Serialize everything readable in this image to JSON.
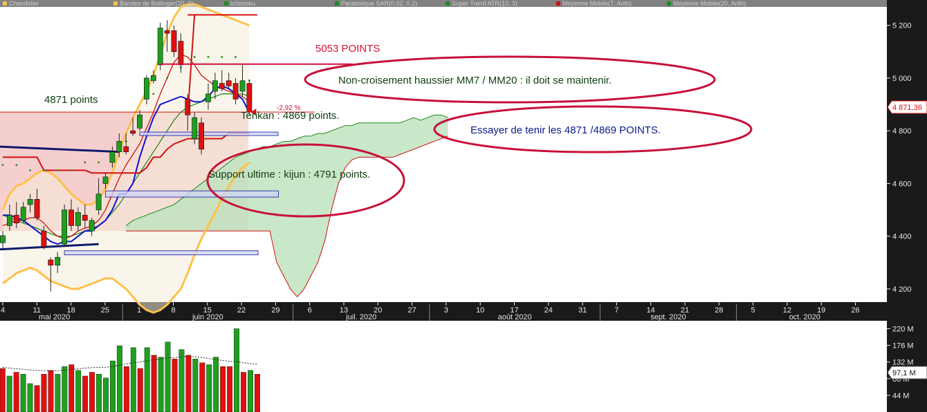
{
  "legend": [
    {
      "label": "Chandelier",
      "color": "#ffc04a"
    },
    {
      "label": "Bandes de Bollinger(20, 2)",
      "color": "#ffc04a"
    },
    {
      "label": "Ichimoku",
      "color": "#1e8a1e"
    },
    {
      "label": "Parabolique SAR(0.02, 0.2)",
      "color": "#1e8a1e"
    },
    {
      "label": "Super Trend ATR(10, 3)",
      "color": "#1e8a1e"
    },
    {
      "label": "Moyenne Mobile(7, Arith)",
      "color": "#d01010"
    },
    {
      "label": "Moyenne Mobile(20, Arith)",
      "color": "#1e8a1e"
    }
  ],
  "annotations": {
    "points_5053": "5053 POINTS",
    "mm_note": "Non-croisement haussier MM7 / MM20 : il doit se maintenir.",
    "points_4871": "4871 points",
    "tenkan": "Tenkan : 4869 points.",
    "pct_change": "-2,92 %",
    "hold_note": "Essayer de tenir les 4871  /4869 POINTS.",
    "kijun": "Support ultime : kijun : 4791 points."
  },
  "price_badge": "4 871,36",
  "volume_badge": "97,1 M",
  "colors": {
    "up": "#1ea01e",
    "down": "#e01010",
    "bollinger": "#ffc04a",
    "annotation_ring": "#c8103a",
    "kumo_fill": "#bfe3bf",
    "shaded_zone": "#f3c2c2",
    "axis_bg": "#1a1a1a"
  },
  "chart_data": [
    {
      "type": "candlestick",
      "y_ticks": [
        "5 200",
        "5 000",
        "4 800",
        "4 600",
        "4 400",
        "4 200"
      ],
      "y_tick_values": [
        5200,
        5000,
        4800,
        4600,
        4400,
        4200
      ],
      "ylim": [
        4150,
        5270
      ],
      "x_tick_labels": [
        "4",
        "11",
        "18",
        "25",
        "1",
        "8",
        "15",
        "22",
        "29",
        "6",
        "13",
        "20",
        "27",
        "3",
        "10",
        "17",
        "24",
        "31",
        "7",
        "14",
        "21",
        "28",
        "5",
        "12",
        "19",
        "26"
      ],
      "months": [
        {
          "label": "mai 2020",
          "start": "4"
        },
        {
          "label": "juin 2020",
          "start": "1"
        },
        {
          "label": "juil. 2020",
          "start": "6"
        },
        {
          "label": "août 2020",
          "start": "3"
        },
        {
          "label": "sept. 2020",
          "start": "7"
        },
        {
          "label": "oct. 2020",
          "start": "5"
        }
      ],
      "candles": [
        {
          "o": 4375,
          "h": 4420,
          "l": 4350,
          "c": 4402
        },
        {
          "o": 4440,
          "h": 4520,
          "l": 4420,
          "c": 4480
        },
        {
          "o": 4480,
          "h": 4530,
          "l": 4430,
          "c": 4450
        },
        {
          "o": 4460,
          "h": 4530,
          "l": 4450,
          "c": 4510
        },
        {
          "o": 4520,
          "h": 4560,
          "l": 4490,
          "c": 4540
        },
        {
          "o": 4540,
          "h": 4580,
          "l": 4460,
          "c": 4470
        },
        {
          "o": 4420,
          "h": 4440,
          "l": 4350,
          "c": 4360
        },
        {
          "o": 4310,
          "h": 4320,
          "l": 4190,
          "c": 4290
        },
        {
          "o": 4290,
          "h": 4340,
          "l": 4260,
          "c": 4320
        },
        {
          "o": 4370,
          "h": 4520,
          "l": 4360,
          "c": 4500
        },
        {
          "o": 4500,
          "h": 4540,
          "l": 4420,
          "c": 4440
        },
        {
          "o": 4440,
          "h": 4510,
          "l": 4420,
          "c": 4490
        },
        {
          "o": 4480,
          "h": 4520,
          "l": 4430,
          "c": 4460
        },
        {
          "o": 4420,
          "h": 4470,
          "l": 4400,
          "c": 4460
        },
        {
          "o": 4500,
          "h": 4620,
          "l": 4480,
          "c": 4560
        },
        {
          "o": 4600,
          "h": 4640,
          "l": 4580,
          "c": 4625
        },
        {
          "o": 4680,
          "h": 4740,
          "l": 4660,
          "c": 4720
        },
        {
          "o": 4720,
          "h": 4790,
          "l": 4700,
          "c": 4760
        },
        {
          "o": 4740,
          "h": 4790,
          "l": 4710,
          "c": 4720
        },
        {
          "o": 4800,
          "h": 4850,
          "l": 4780,
          "c": 4790
        },
        {
          "o": 4810,
          "h": 4880,
          "l": 4800,
          "c": 4860
        },
        {
          "o": 4920,
          "h": 5010,
          "l": 4900,
          "c": 5000
        },
        {
          "o": 4990,
          "h": 5030,
          "l": 4980,
          "c": 5010
        },
        {
          "o": 5050,
          "h": 5210,
          "l": 5030,
          "c": 5190
        },
        {
          "o": 5180,
          "h": 5220,
          "l": 5100,
          "c": 5170
        },
        {
          "o": 5180,
          "h": 5200,
          "l": 5080,
          "c": 5100
        },
        {
          "o": 5140,
          "h": 5170,
          "l": 5020,
          "c": 5050
        },
        {
          "o": 4920,
          "h": 4940,
          "l": 4800,
          "c": 4860
        },
        {
          "o": 4770,
          "h": 4870,
          "l": 4750,
          "c": 4850
        },
        {
          "o": 4830,
          "h": 4850,
          "l": 4710,
          "c": 4730
        },
        {
          "o": 4910,
          "h": 4980,
          "l": 4880,
          "c": 4940
        },
        {
          "o": 4950,
          "h": 5020,
          "l": 4920,
          "c": 4990
        },
        {
          "o": 4980,
          "h": 5030,
          "l": 4950,
          "c": 4960
        },
        {
          "o": 4990,
          "h": 5020,
          "l": 4960,
          "c": 4970
        },
        {
          "o": 4980,
          "h": 5000,
          "l": 4900,
          "c": 4920
        },
        {
          "o": 4950,
          "h": 5050,
          "l": 4930,
          "c": 4990
        },
        {
          "o": 4980,
          "h": 4990,
          "l": 4860,
          "c": 4871
        }
      ],
      "bollinger_upper": [
        4500,
        4560,
        4590,
        4600,
        4620,
        4640,
        4650,
        4640,
        4620,
        4590,
        4560,
        4540,
        4520,
        4520,
        4540,
        4580,
        4640,
        4720,
        4790,
        4850,
        4900,
        4950,
        5010,
        5090,
        5170,
        5230,
        5270,
        5280,
        5280,
        5270,
        5260,
        5250,
        5240,
        5230,
        5220,
        5210,
        5200
      ],
      "bollinger_lower": [
        4220,
        4240,
        4260,
        4270,
        4280,
        4270,
        4250,
        4230,
        4220,
        4210,
        4200,
        4200,
        4210,
        4220,
        4230,
        4240,
        4240,
        4220,
        4200,
        4170,
        4140,
        4120,
        4110,
        4120,
        4140,
        4170,
        4200,
        4260,
        4330,
        4390,
        4440,
        4490,
        4540,
        4590,
        4630,
        4660,
        4680
      ],
      "mm7": [
        4440,
        4450,
        4460,
        4460,
        4470,
        4470,
        4450,
        4420,
        4400,
        4390,
        4400,
        4420,
        4430,
        4440,
        4460,
        4500,
        4560,
        4620,
        4670,
        4710,
        4750,
        4810,
        4870,
        4940,
        5000,
        5060,
        5090,
        5080,
        5050,
        5010,
        4990,
        4970,
        4960,
        4950,
        4940,
        4930,
        4910
      ],
      "mm20": [
        4480,
        4470,
        4460,
        4450,
        4440,
        4430,
        4420,
        4410,
        4400,
        4400,
        4400,
        4410,
        4420,
        4430,
        4440,
        4460,
        4490,
        4520,
        4560,
        4600,
        4640,
        4680,
        4720,
        4760,
        4800,
        4840,
        4870,
        4890,
        4900,
        4910,
        4920,
        4930,
        4940,
        4940,
        4940,
        4940,
        4930
      ],
      "tenkan": [
        4480,
        4480,
        4470,
        4460,
        4440,
        4420,
        4400,
        4380,
        4370,
        4380,
        4380,
        4400,
        4420,
        4420,
        4440,
        4460,
        4500,
        4560,
        4560,
        4600,
        4700,
        4780,
        4850,
        4900,
        4910,
        4920,
        4930,
        4920,
        4910,
        4910,
        4930,
        4960,
        4970,
        4960,
        4940,
        4920,
        4869
      ],
      "kijun": [
        4700,
        4700,
        4700,
        4700,
        4700,
        4700,
        4650,
        4650,
        4650,
        4650,
        4650,
        4650,
        4650,
        4640,
        4640,
        4640,
        4640,
        4640,
        4640,
        4640,
        4640,
        4660,
        4700,
        4700,
        4730,
        4750,
        4760,
        4770,
        4770,
        4770,
        4770,
        4770,
        4770,
        4791,
        4791,
        4791,
        4791
      ],
      "supertrend": [
        4550,
        4550,
        4550,
        4540,
        4530,
        4530,
        4530,
        4530,
        4530,
        4530,
        4530,
        4540,
        4560,
        4560,
        4560,
        4600,
        4600,
        4620,
        4640,
        4680,
        4730,
        4800,
        4820,
        4860,
        4880,
        4900,
        4920,
        4960,
        4960,
        4960,
        4960,
        4960,
        4960,
        4960,
        4960,
        4960,
        4871
      ],
      "kumo": {
        "start_index": 18,
        "span_a": [
          4440,
          4460,
          4470,
          4480,
          4490,
          4500,
          4510,
          4520,
          4540,
          4560,
          4580,
          4600,
          4620,
          4640,
          4660,
          4680,
          4700,
          4710,
          4720,
          4730,
          4740,
          4740,
          4750,
          4760,
          4760,
          4770,
          4780,
          4780,
          4790,
          4790,
          4800,
          4810,
          4820,
          4820,
          4830,
          4830,
          4830,
          4830,
          4830,
          4830,
          4830,
          4840,
          4850,
          4840,
          4850,
          4860,
          4860,
          4850
        ],
        "span_b": [
          4420,
          4420,
          4420,
          4420,
          4420,
          4420,
          4420,
          4420,
          4420,
          4420,
          4420,
          4420,
          4420,
          4420,
          4420,
          4420,
          4420,
          4420,
          4420,
          4420,
          4420,
          4420,
          4300,
          4250,
          4200,
          4170,
          4200,
          4250,
          4300,
          4380,
          4500,
          4600,
          4660,
          4690,
          4700,
          4700,
          4700,
          4700,
          4700,
          4700,
          4710,
          4720,
          4730,
          4740,
          4750,
          4760,
          4770,
          4780
        ]
      },
      "level_lines": [
        {
          "label": "5053 POINTS",
          "value": 5053
        },
        {
          "label": "4871 points",
          "value": 4871
        }
      ]
    },
    {
      "type": "bar",
      "y_ticks": [
        "220 M",
        "176 M",
        "132 M",
        "88 M",
        "44 M"
      ],
      "y_tick_values": [
        220,
        176,
        132,
        88,
        44
      ],
      "ylim": [
        0,
        230
      ],
      "values": [
        115,
        95,
        105,
        100,
        75,
        70,
        100,
        110,
        100,
        120,
        125,
        110,
        95,
        105,
        100,
        90,
        135,
        175,
        120,
        170,
        115,
        170,
        150,
        145,
        185,
        140,
        165,
        150,
        140,
        130,
        125,
        145,
        120,
        120,
        220,
        105,
        110,
        100
      ],
      "up": [
        false,
        true,
        false,
        true,
        true,
        false,
        false,
        false,
        true,
        true,
        false,
        true,
        false,
        false,
        true,
        true,
        true,
        true,
        false,
        true,
        false,
        true,
        false,
        true,
        true,
        false,
        true,
        false,
        true,
        false,
        true,
        true,
        false,
        false,
        true,
        false,
        true,
        false
      ],
      "ma_values": [
        118,
        116,
        114,
        113,
        111,
        110,
        109,
        109,
        109,
        111,
        113,
        114,
        116,
        117,
        118,
        118,
        120,
        124,
        127,
        130,
        132,
        135,
        138,
        140,
        143,
        144,
        146,
        147,
        146,
        144,
        141,
        139,
        136,
        134,
        133,
        130,
        128,
        126
      ]
    }
  ]
}
